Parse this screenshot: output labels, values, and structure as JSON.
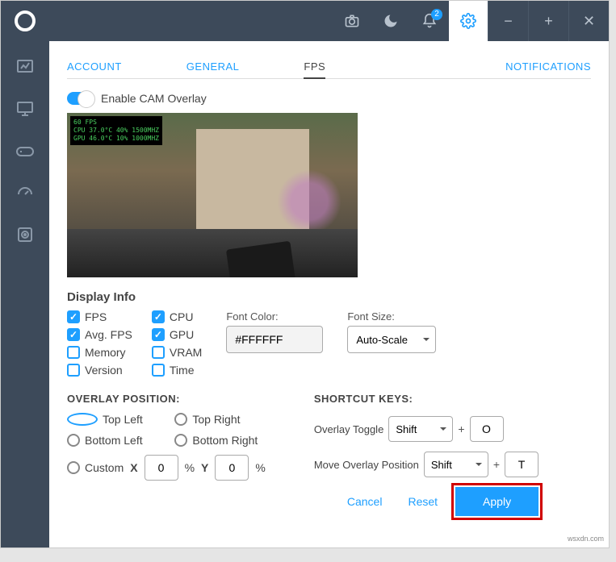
{
  "notifications_badge": "2",
  "tabs": {
    "account": "ACCOUNT",
    "general": "GENERAL",
    "fps": "FPS",
    "notifications": "NOTIFICATIONS"
  },
  "enable_overlay_label": "Enable CAM Overlay",
  "preview_overlay_text": "60 FPS\nCPU 37.0°C 40% 1500MHZ\nGPU 46.0°C 10% 1000MHZ",
  "display_info": {
    "heading": "Display Info",
    "fps": "FPS",
    "cpu": "CPU",
    "avg_fps": "Avg. FPS",
    "gpu": "GPU",
    "memory": "Memory",
    "vram": "VRAM",
    "version": "Version",
    "time": "Time"
  },
  "font_color": {
    "label": "Font Color:",
    "value": "#FFFFFF"
  },
  "font_size": {
    "label": "Font Size:",
    "value": "Auto-Scale"
  },
  "overlay_position": {
    "heading": "OVERLAY POSITION:",
    "top_left": "Top Left",
    "top_right": "Top Right",
    "bottom_left": "Bottom Left",
    "bottom_right": "Bottom Right",
    "custom": "Custom",
    "x_label": "X",
    "y_label": "Y",
    "x_value": "0",
    "y_value": "0",
    "pct": "%"
  },
  "shortcut": {
    "heading": "SHORTCUT KEYS:",
    "toggle_label": "Overlay Toggle",
    "move_label": "Move Overlay Position",
    "toggle_mod": "Shift",
    "toggle_key": "O",
    "move_mod": "Shift",
    "move_key": "T",
    "plus": "+"
  },
  "actions": {
    "cancel": "Cancel",
    "reset": "Reset",
    "apply": "Apply"
  },
  "watermark": "wsxdn.com"
}
